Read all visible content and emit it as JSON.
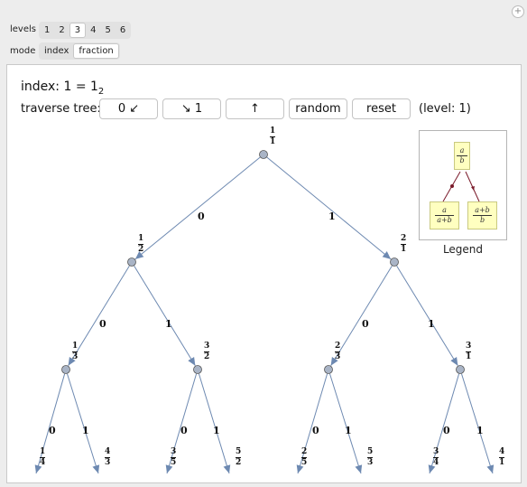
{
  "controls": {
    "plus_icon": "+",
    "levels_label": "levels",
    "levels": [
      "1",
      "2",
      "3",
      "4",
      "5",
      "6"
    ],
    "levels_selected": "3",
    "mode_label": "mode",
    "modes": [
      "index",
      "fraction"
    ],
    "mode_selected": "fraction"
  },
  "panel": {
    "index_prefix": "index: 1 = 1",
    "index_sub": "2",
    "traverse_label": "traverse tree:",
    "buttons": [
      "0 ↙",
      "↘ 1",
      "↑",
      "random",
      "reset"
    ],
    "level_text": "(level: 1)"
  },
  "tree": {
    "edge_labels": [
      "0",
      "1",
      "0",
      "1",
      "0",
      "1",
      "0",
      "1",
      "0",
      "1",
      "0",
      "1",
      "0",
      "1"
    ],
    "fractions": [
      {
        "n": "1",
        "d": "1"
      },
      {
        "n": "1",
        "d": "2"
      },
      {
        "n": "2",
        "d": "1"
      },
      {
        "n": "1",
        "d": "3"
      },
      {
        "n": "3",
        "d": "2"
      },
      {
        "n": "2",
        "d": "3"
      },
      {
        "n": "3",
        "d": "1"
      },
      {
        "n": "1",
        "d": "4"
      },
      {
        "n": "4",
        "d": "3"
      },
      {
        "n": "3",
        "d": "5"
      },
      {
        "n": "5",
        "d": "2"
      },
      {
        "n": "2",
        "d": "5"
      },
      {
        "n": "5",
        "d": "3"
      },
      {
        "n": "3",
        "d": "4"
      },
      {
        "n": "4",
        "d": "1"
      }
    ],
    "colors": {
      "edge": "#6d89b1",
      "node_fill": "#a9b4c6",
      "node_stroke": "#555"
    }
  },
  "legend": {
    "parent": {
      "n": "a",
      "d": "b"
    },
    "left": {
      "n": "a",
      "d": "a+b"
    },
    "right": {
      "n": "a+b",
      "d": "b"
    },
    "caption": "Legend",
    "colors": {
      "box": "#ffffc0",
      "edge": "#7a1a2a"
    }
  }
}
